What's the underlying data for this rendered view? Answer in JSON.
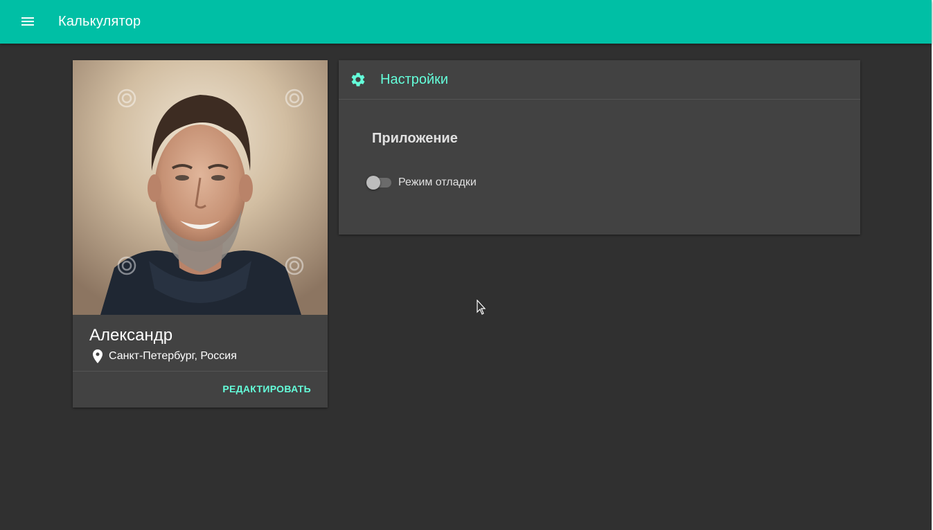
{
  "app": {
    "title": "Калькулятор",
    "accent_color": "#00bfa5",
    "highlight_color": "#64ffda",
    "background_color": "#303030",
    "card_color": "#424242"
  },
  "header": {
    "menu_icon": "menu-icon"
  },
  "profile": {
    "photo_alt": "profile-photo",
    "name": "Александр",
    "location_icon": "location-pin-icon",
    "location": "Санкт-Петербург, Россия",
    "edit_label": "РЕДАКТИРОВАТЬ"
  },
  "settings": {
    "icon": "gear-icon",
    "title": "Настройки",
    "section_title": "Приложение",
    "debug_toggle": {
      "label": "Режим отладки",
      "checked": false
    }
  }
}
